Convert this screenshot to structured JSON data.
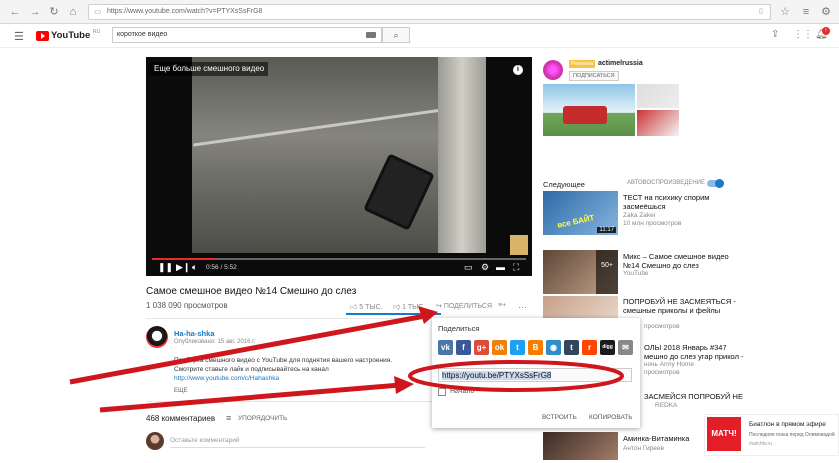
{
  "browser": {
    "url": "https://www.youtube.com/watch?v=PTYXsSsFrG8"
  },
  "yt": {
    "logo_text": "YouTube",
    "logo_region": "RU",
    "search_value": "короткое видео"
  },
  "player": {
    "overlay_title": "Еще больше смешного видео",
    "time": "0:56 / 5:52"
  },
  "video": {
    "title": "Самое смешное видео №14 Смешно до слез",
    "views": "1 038 090 просмотров",
    "likes": "5 ТЫС.",
    "dislikes": "1 ТЫС.",
    "share_label": "ПОДЕЛИТЬСЯ"
  },
  "channel": {
    "name": "Ha-ha-shka",
    "published": "Опубликовано: 15 авг. 2016 г.",
    "desc_line1": "Подборка смешного видео с YouTube для поднятия вашего настроения.",
    "desc_line2": "Смотрите ставьте лайк и подписывайтесь на канал",
    "link": "http://www.youtube.com/c/Hahashka",
    "more": "ЕЩЕ"
  },
  "comments": {
    "count": "468 комментариев",
    "sort": "УПОРЯДОЧИТЬ",
    "placeholder": "Оставьте комментарий"
  },
  "sidebar_ad": {
    "badge": "Реклама",
    "channel": "actimelrussia",
    "subscribe": "ПОДПИСАТЬСЯ"
  },
  "next": {
    "label": "Следующее",
    "autoplay": "АВТОВОСПРОИЗВЕДЕНИЕ"
  },
  "related": [
    {
      "title1": "ТЕСТ на психику спорим",
      "title2": "засмеёшься",
      "channel": "Zaka Zakei",
      "meta": "10 млн просмотров",
      "duration": "11:17",
      "thumb_text": "все БАЙТ"
    },
    {
      "title1": "Микс – Самое смешное видео",
      "title2": "№14 Смешно до слез",
      "channel": "YouTube",
      "meta": "",
      "duration": "",
      "thumb_text": "50+"
    },
    {
      "title1": "ПОПРОБУЙ НЕ ЗАСМЕЯТЬСЯ -",
      "title2": "смешные приколы и фейлы",
      "channel": "просмотров",
      "meta": "",
      "duration": "",
      "thumb_text": ""
    },
    {
      "title1": "ОЛЫ 2018 Январь #347",
      "title2": "мешно до слез угар прикол -",
      "channel": "ночь Army Home",
      "meta": "просмотров",
      "duration": "",
      "thumb_text": ""
    },
    {
      "title1": "ЗАСМЕЙСЯ ПОПРОБУЙ НЕ",
      "title2": "",
      "channel": "REDKA",
      "meta": "",
      "duration": "",
      "thumb_text": ""
    },
    {
      "title1": "Аминка-Витаминка",
      "title2": "",
      "channel": "Антон Гиреев",
      "meta": "",
      "duration": "",
      "thumb_text": ""
    }
  ],
  "share_popup": {
    "title": "Поделиться",
    "link": "https://youtu.be/PTYXsSsFrG8",
    "start_label": "Начало",
    "embed": "ВСТРОИТЬ",
    "copy": "КОПИРОВАТЬ",
    "icons": [
      {
        "name": "vk-icon",
        "glyph": "vk",
        "color": "#4a76a8"
      },
      {
        "name": "facebook-icon",
        "glyph": "f",
        "color": "#3b5998"
      },
      {
        "name": "googleplus-icon",
        "glyph": "g+",
        "color": "#dd4b39"
      },
      {
        "name": "odnoklassniki-icon",
        "glyph": "ok",
        "color": "#ee8208"
      },
      {
        "name": "twitter-icon",
        "glyph": "t",
        "color": "#1da1f2"
      },
      {
        "name": "blogger-icon",
        "glyph": "B",
        "color": "#f57d00"
      },
      {
        "name": "liveinternet-icon",
        "glyph": "◉",
        "color": "#2c8fc9"
      },
      {
        "name": "tumblr-icon",
        "glyph": "t",
        "color": "#35465c"
      },
      {
        "name": "reddit-icon",
        "glyph": "r",
        "color": "#ff4500"
      },
      {
        "name": "digg-icon",
        "glyph": "digg",
        "color": "#1b1b1b"
      },
      {
        "name": "email-icon",
        "glyph": "✉",
        "color": "#888888"
      }
    ]
  },
  "match_ad": {
    "logo": "МАТЧ!",
    "headline": "Биатлон в прямом эфире",
    "sub": "Последняя гонка перед Олимпиадой",
    "url": "matchtv.ru"
  },
  "colors": {
    "youtube_red": "#ff0000",
    "annotation_red": "#d0161d",
    "link_blue": "#167ac6"
  }
}
